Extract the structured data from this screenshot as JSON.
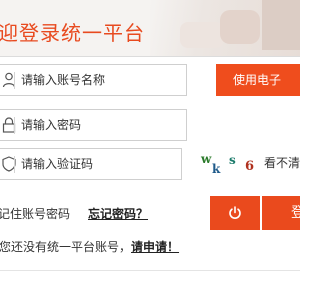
{
  "header": {
    "title": "迎登录统一平台"
  },
  "form": {
    "username": {
      "value": "",
      "placeholder": "请输入账号名称"
    },
    "password": {
      "value": "",
      "placeholder": "请输入密码"
    },
    "captcha": {
      "value": "",
      "placeholder": "请输入验证码"
    }
  },
  "cert_button": {
    "label": "使用电子"
  },
  "captcha_image": {
    "chars": [
      "w",
      "k",
      "s",
      "6"
    ],
    "colors": [
      "#2a7a2a",
      "#1e5a8a",
      "#1a7a6a",
      "#b0311f"
    ]
  },
  "captcha_refresh_label": "看不清",
  "remember_label": "记住账号密码",
  "forgot_label": "忘记密码？",
  "login_button": {
    "label": "登"
  },
  "register": {
    "text": "您还没有统一平台账号，",
    "link_label": "请申请！"
  },
  "icons": {
    "username": "user-icon",
    "password": "lock-icon",
    "captcha": "shield-icon",
    "ca_button": "power-icon"
  },
  "colors": {
    "accent": "#ea4a1d",
    "title": "#e84a1f",
    "header_bg": "#f5f3f1"
  }
}
